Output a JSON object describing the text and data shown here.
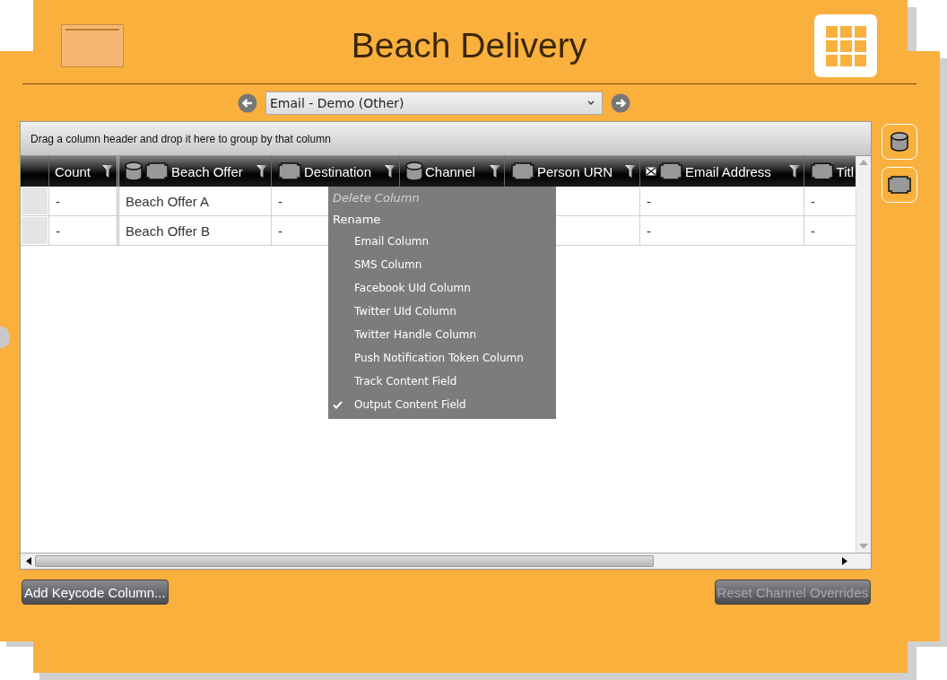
{
  "header": {
    "title": "Beach Delivery"
  },
  "channel_selector": {
    "value": "Email - Demo (Other)"
  },
  "grid": {
    "group_hint": "Drag a column header and drop it here to group by that column",
    "columns": [
      {
        "label": "Count",
        "source": false,
        "email": false,
        "field": false,
        "filter": true
      },
      {
        "label": "Beach Offer",
        "source": true,
        "email": false,
        "field": true,
        "filter": true
      },
      {
        "label": "Destination",
        "source": false,
        "email": false,
        "field": true,
        "filter": true
      },
      {
        "label": "Channel",
        "source": true,
        "email": false,
        "field": false,
        "filter": true
      },
      {
        "label": "Person URN",
        "source": false,
        "email": false,
        "field": true,
        "filter": true
      },
      {
        "label": "Email Address",
        "source": false,
        "email": true,
        "field": true,
        "filter": true
      },
      {
        "label": "Titl",
        "source": false,
        "email": false,
        "field": true,
        "filter": false
      }
    ],
    "rows": [
      {
        "cells": [
          "-",
          "Beach Offer A",
          "-",
          null,
          null,
          "-",
          "-"
        ]
      },
      {
        "cells": [
          "-",
          "Beach Offer B",
          "-",
          null,
          null,
          "-",
          "-"
        ]
      }
    ]
  },
  "context_menu": [
    {
      "kind": "command",
      "label": "Delete Column",
      "disabled": true
    },
    {
      "kind": "command",
      "label": "Rename",
      "disabled": false
    },
    {
      "kind": "option",
      "label": "Email Column",
      "checked": false
    },
    {
      "kind": "option",
      "label": "SMS Column",
      "checked": false
    },
    {
      "kind": "option",
      "label": "Facebook UId Column",
      "checked": false
    },
    {
      "kind": "option",
      "label": "Twitter UId Column",
      "checked": false
    },
    {
      "kind": "option",
      "label": "Twitter Handle Column",
      "checked": false
    },
    {
      "kind": "option",
      "label": "Push Notification Token Column",
      "checked": false
    },
    {
      "kind": "option",
      "label": "Track Content Field",
      "checked": false
    },
    {
      "kind": "option",
      "label": "Output Content Field",
      "checked": true
    }
  ],
  "buttons": [
    {
      "label": "Add Keycode Column...",
      "disabled": false
    },
    {
      "label": "Reset Channel Overrides",
      "disabled": true
    }
  ]
}
